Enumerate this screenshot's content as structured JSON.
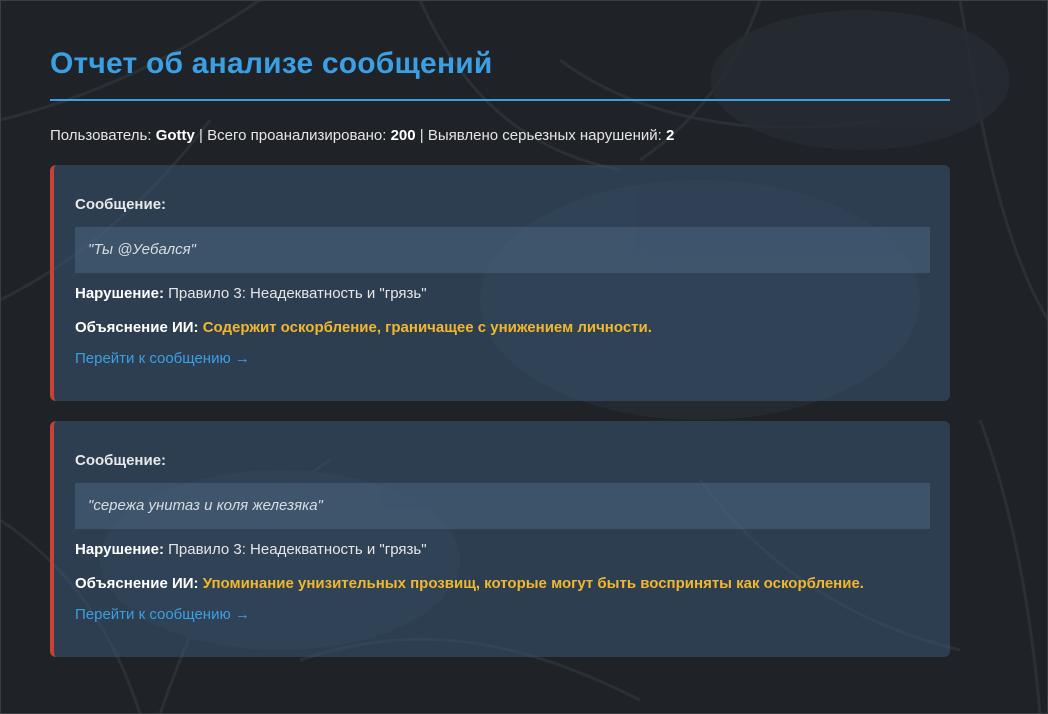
{
  "report": {
    "title": "Отчет об анализе сообщений",
    "summary": {
      "user_label": "Пользователь:",
      "user_value": "Gotty",
      "total_label": "Всего проанализировано:",
      "total_value": "200",
      "violations_label": "Выявлено серьезных нарушений:",
      "violations_value": "2",
      "separator": "|"
    }
  },
  "colors": {
    "accent": "#3b9fe3",
    "warning": "#f1b82d",
    "danger_border": "#c94334"
  },
  "cards": [
    {
      "message_label": "Сообщение:",
      "message_text": "\"Ты @Уебался\"",
      "violation_label": "Нарушение:",
      "violation_text": "Правило 3: Неадекватность и \"грязь\"",
      "ai_label": "Объяснение ИИ:",
      "ai_text": "Содержит оскорбление, граничащее с унижением личности.",
      "link_text": "Перейти к сообщению →"
    },
    {
      "message_label": "Сообщение:",
      "message_text": "\"сережа унитаз и коля железяка\"",
      "violation_label": "Нарушение:",
      "violation_text": "Правило 3: Неадекватность и \"грязь\"",
      "ai_label": "Объяснение ИИ:",
      "ai_text": "Упоминание унизительных прозвищ, которые могут быть восприняты как оскорбление.",
      "link_text": "Перейти к сообщению →"
    }
  ]
}
